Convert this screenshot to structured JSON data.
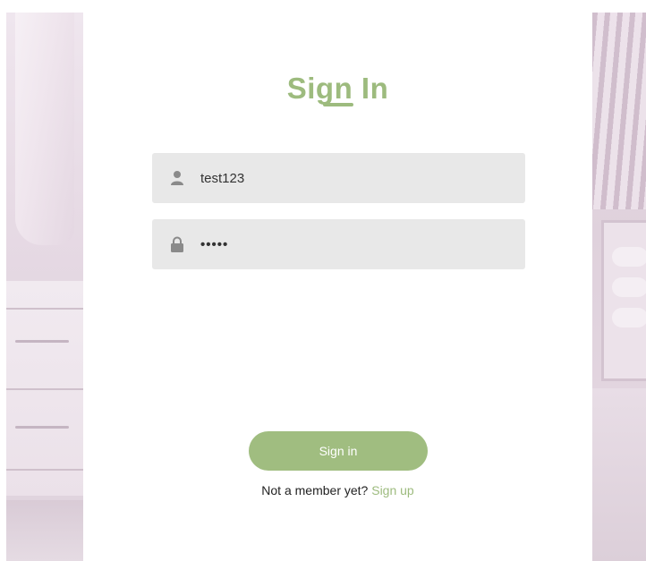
{
  "page": {
    "title": "Sign In"
  },
  "form": {
    "username_value": "test123",
    "password_value": "12345",
    "username_icon": "user-icon",
    "password_icon": "lock-icon"
  },
  "actions": {
    "signin_label": "Sign in",
    "signup_prompt": "Not a member yet?",
    "signup_link": "Sign up"
  },
  "colors": {
    "accent": "#9dbb7e",
    "field_bg": "#e8e8e8",
    "icon_gray": "#8a8a8a"
  }
}
